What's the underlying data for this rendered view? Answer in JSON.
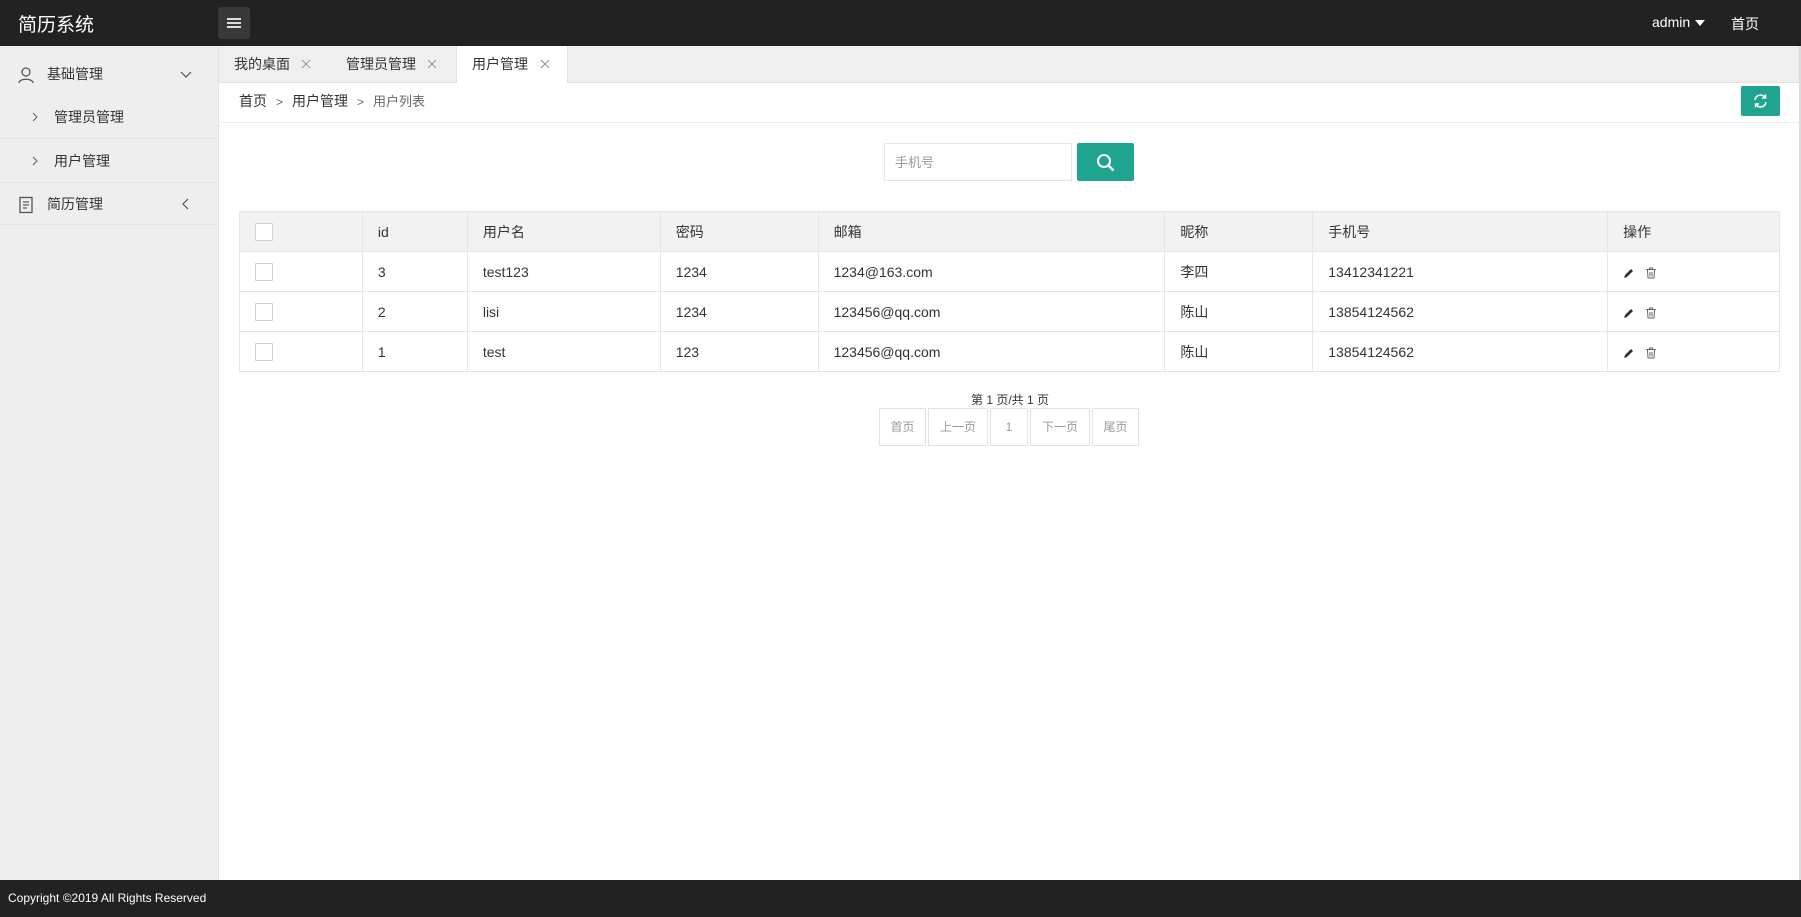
{
  "app": {
    "title": "简历系统"
  },
  "header": {
    "user": "admin",
    "home": "首页"
  },
  "sidebar": {
    "groups": [
      {
        "label": "基础管理",
        "icon": "user-icon",
        "items": [
          {
            "label": "管理员管理"
          },
          {
            "label": "用户管理"
          }
        ]
      },
      {
        "label": "简历管理",
        "icon": "document-icon",
        "items": []
      }
    ]
  },
  "tabs": [
    {
      "label": "我的桌面"
    },
    {
      "label": "管理员管理"
    },
    {
      "label": "用户管理",
      "active": true
    }
  ],
  "breadcrumb": {
    "items": [
      "首页",
      "用户管理"
    ],
    "separator": ">",
    "current": "用户列表"
  },
  "search": {
    "placeholder": "手机号",
    "value": ""
  },
  "table": {
    "columns": [
      "id",
      "用户名",
      "密码",
      "邮箱",
      "昵称",
      "手机号",
      "操作"
    ],
    "rows": [
      {
        "id": "3",
        "username": "test123",
        "password": "1234",
        "email": "1234@163.com",
        "nickname": "李四",
        "phone": "13412341221"
      },
      {
        "id": "2",
        "username": "lisi",
        "password": "1234",
        "email": "123456@qq.com",
        "nickname": "陈山",
        "phone": "13854124562"
      },
      {
        "id": "1",
        "username": "test",
        "password": "123",
        "email": "123456@qq.com",
        "nickname": "陈山",
        "phone": "13854124562"
      }
    ]
  },
  "pagination": {
    "info": "第 1 页/共 1 页",
    "first": "首页",
    "prev": "上一页",
    "page": "1",
    "next": "下一页",
    "last": "尾页"
  },
  "footer": {
    "copyright": "Copyright ©2019 All Rights Reserved"
  },
  "colors": {
    "header": "#222222",
    "accent": "#1fa491",
    "sidebar": "#eeeeee"
  }
}
